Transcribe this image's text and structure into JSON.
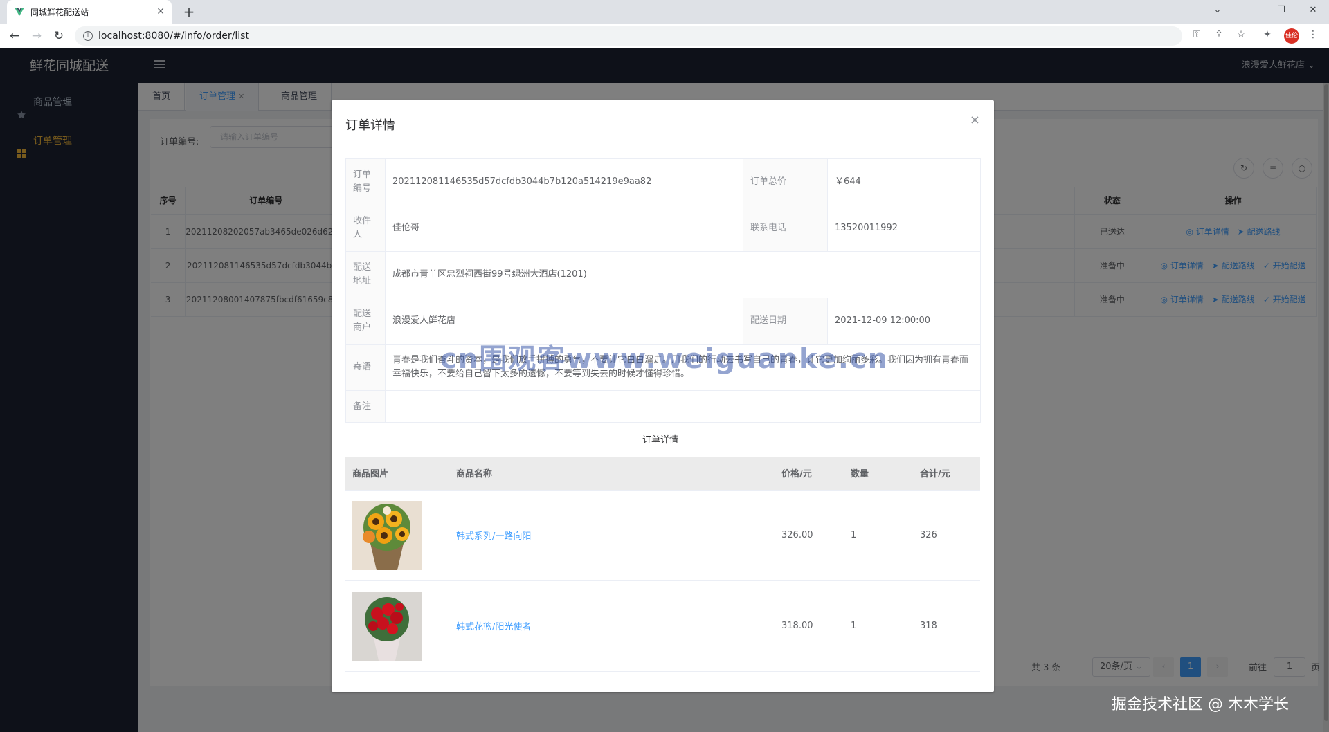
{
  "browser": {
    "tab_title": "同城鲜花配送站",
    "new_tab": "+",
    "url": "localhost:8080/#/info/order/list",
    "profile_initials": "佳伦"
  },
  "app": {
    "brand": "鲜花同城配送",
    "user_name": "浪漫爱人鲜花店",
    "accent_color": "#409eff",
    "sidebar_bg": "#1c2333"
  },
  "sidebar": {
    "items": [
      {
        "label": "商品管理",
        "icon": "star-icon"
      },
      {
        "label": "订单管理",
        "icon": "grid-icon"
      }
    ]
  },
  "tags": [
    {
      "label": "首页"
    },
    {
      "label": "订单管理"
    },
    {
      "label": "商品管理"
    }
  ],
  "search": {
    "label": "订单编号:",
    "placeholder": "请输入订单编号"
  },
  "table": {
    "headers": {
      "index": "序号",
      "order_no": "订单编号",
      "status": "状态",
      "actions": "操作"
    },
    "rows": [
      {
        "index": "1",
        "order_no": "20211208202057ab3465de026d62e...",
        "status": "已送达",
        "actions": [
          "订单详情",
          "配送路线"
        ]
      },
      {
        "index": "2",
        "order_no": "202112081146535d57dcfdb3044b7...",
        "status": "准备中",
        "actions": [
          "订单详情",
          "配送路线",
          "开始配送"
        ]
      },
      {
        "index": "3",
        "order_no": "20211208001407875fbcdf61659c8c...",
        "status": "准备中",
        "actions": [
          "订单详情",
          "配送路线",
          "开始配送"
        ]
      }
    ]
  },
  "pagination": {
    "total": "共 3 条",
    "page_size": "20条/页",
    "current": "1",
    "goto_label": "前往",
    "goto_value": "1",
    "page_unit": "页"
  },
  "dialog": {
    "title": "订单详情",
    "close": "×",
    "details": {
      "order_no_label": "订单编号",
      "order_no": "202112081146535d57dcfdb3044b7b120a514219e9aa82",
      "total_label": "订单总价",
      "total": "￥644",
      "receiver_label": "收件人",
      "receiver": "佳伦哥",
      "phone_label": "联系电话",
      "phone": "13520011992",
      "address_label": "配送地址",
      "address": "成都市青羊区忠烈祠西街99号绿洲大酒店(1201)",
      "merchant_label": "配送商户",
      "merchant": "浪漫爱人鲜花店",
      "date_label": "配送日期",
      "date": "2021-12-09 12:00:00",
      "message_label": "寄语",
      "message": "青春是我们奋斗的资本，是我们放手拼搏的勇气，不要让它白白溜走。用我们的行动去书写自己的青春，让它更加绚丽多彩。我们因为拥有青春而幸福快乐，不要给自己留下太多的遗憾，不要等到失去的时候才懂得珍惜。",
      "remark_label": "备注",
      "remark": ""
    },
    "divider": "订单详情",
    "products": {
      "headers": {
        "image": "商品图片",
        "name": "商品名称",
        "price": "价格/元",
        "qty": "数量",
        "subtotal": "合计/元"
      },
      "items": [
        {
          "name": "韩式系列/一路向阳",
          "price": "326.00",
          "qty": "1",
          "subtotal": "326",
          "image": "sunflower-bouquet-image"
        },
        {
          "name": "韩式花篮/阳光使者",
          "price": "318.00",
          "qty": "1",
          "subtotal": "318",
          "image": "red-rose-bouquet-image"
        }
      ]
    }
  },
  "overlay": {
    "watermark": "cn围观客www.weiguanke.cn",
    "credit": "掘金技术社区 @ 木木学长"
  }
}
